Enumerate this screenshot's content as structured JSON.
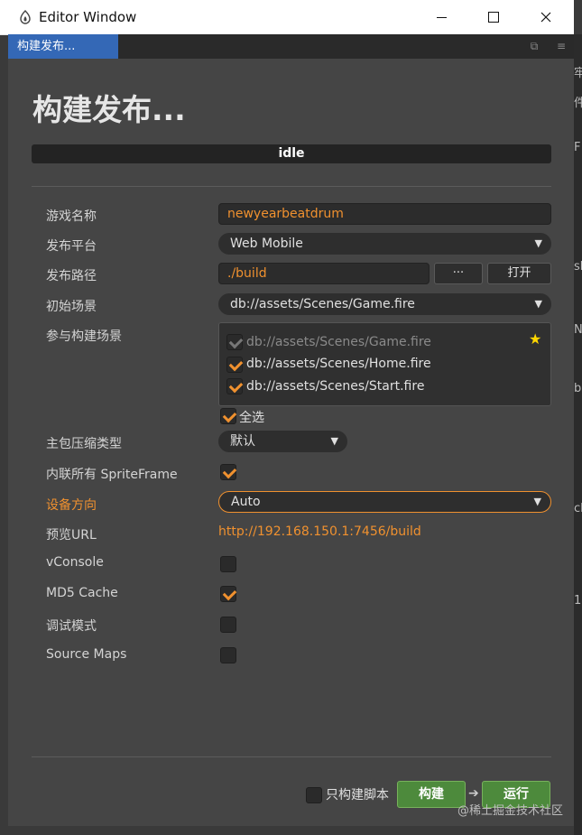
{
  "window": {
    "title": "Editor Window",
    "minimize": "—",
    "maximize": "☐",
    "close": "✕"
  },
  "tab": {
    "label": "构建发布..."
  },
  "panel": {
    "heading": "构建发布...",
    "status": "idle",
    "rows": {
      "game_name": {
        "label": "游戏名称",
        "value": "newyearbeatdrum"
      },
      "platform": {
        "label": "发布平台",
        "value": "Web Mobile"
      },
      "build_path": {
        "label": "发布路径",
        "value": "./build",
        "browse": "···",
        "open": "打开"
      },
      "start_scene": {
        "label": "初始场景",
        "value": "db://assets/Scenes/Game.fire"
      },
      "scenes": {
        "label": "参与构建场景",
        "items": [
          {
            "path": "db://assets/Scenes/Game.fire",
            "checked": true,
            "disabled": true
          },
          {
            "path": "db://assets/Scenes/Home.fire",
            "checked": true,
            "disabled": false
          },
          {
            "path": "db://assets/Scenes/Start.fire",
            "checked": true,
            "disabled": false
          }
        ],
        "select_all": "全选"
      },
      "compression": {
        "label": "主包压缩类型",
        "value": "默认"
      },
      "inline_spriteframe": {
        "label": "内联所有 SpriteFrame",
        "checked": true
      },
      "orientation": {
        "label": "设备方向",
        "value": "Auto"
      },
      "preview_url": {
        "label": "预览URL",
        "value": "http://192.168.150.1:7456/build"
      },
      "vconsole": {
        "label": "vConsole",
        "checked": false
      },
      "md5": {
        "label": "MD5 Cache",
        "checked": true
      },
      "debug": {
        "label": "调试模式",
        "checked": false
      },
      "source_maps": {
        "label": "Source Maps",
        "checked": false
      }
    },
    "footer": {
      "script_only_label": "只构建脚本",
      "build_button": "构建",
      "run_button": "运行"
    }
  },
  "watermark": "@稀土掘金技术社区",
  "background_glyphs": [
    "牢",
    "件",
    "F",
    "sh",
    "N",
    "be",
    "cl",
    "1"
  ],
  "colors": {
    "accent": "#f0912f",
    "tab_active": "#3468b6",
    "green_button": "#4d8a3c"
  }
}
